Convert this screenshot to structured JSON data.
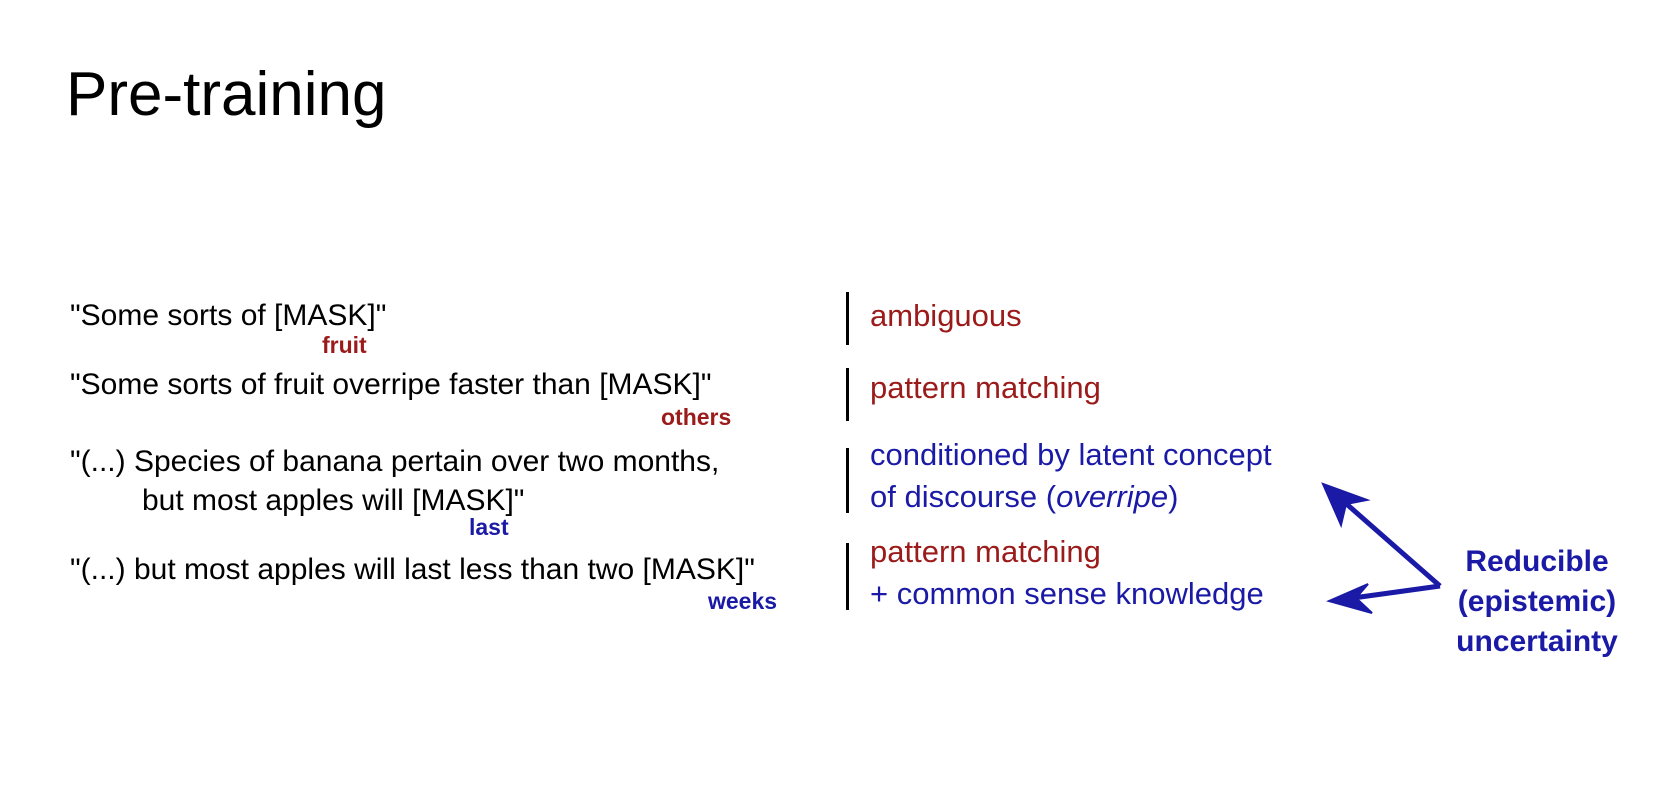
{
  "title": "Pre-training",
  "rows": [
    {
      "sentence_lines": [
        "\"Some sorts of [MASK]\""
      ],
      "answer": "fruit",
      "answer_color": "#9b1a1a",
      "description_lines": [
        "ambiguous"
      ],
      "description_color": "#9b1a1a"
    },
    {
      "sentence_lines": [
        "\"Some sorts of fruit overripe faster than [MASK]\""
      ],
      "answer": "others",
      "answer_color": "#9b1a1a",
      "description_lines": [
        "pattern matching"
      ],
      "description_color": "#9b1a1a"
    },
    {
      "sentence_lines": [
        "\"(...) Species of banana pertain over two months,",
        "but most apples will [MASK]\""
      ],
      "answer": "last",
      "answer_color": "#1a1aa6",
      "description_lines": [
        "conditioned by latent concept",
        "of discourse ("
      ],
      "description_italic": "overripe",
      "description_close": ")",
      "description_color": "#1a1aa6"
    },
    {
      "sentence_lines": [
        "\"(...) but most apples will last less than two [MASK]\""
      ],
      "answer": "weeks",
      "answer_color": "#1a1aa6",
      "description_lines": [
        "pattern matching",
        "+ common sense knowledge"
      ],
      "description_colors": [
        "#9b1a1a",
        "#1a1aa6"
      ]
    }
  ],
  "callout": {
    "lines": [
      "Reducible",
      "(epistemic)",
      "uncertainty"
    ],
    "color": "#1a1aa6"
  },
  "colors": {
    "red": "#9b1a1a",
    "blue": "#1a1aa6",
    "text": "#000000"
  }
}
